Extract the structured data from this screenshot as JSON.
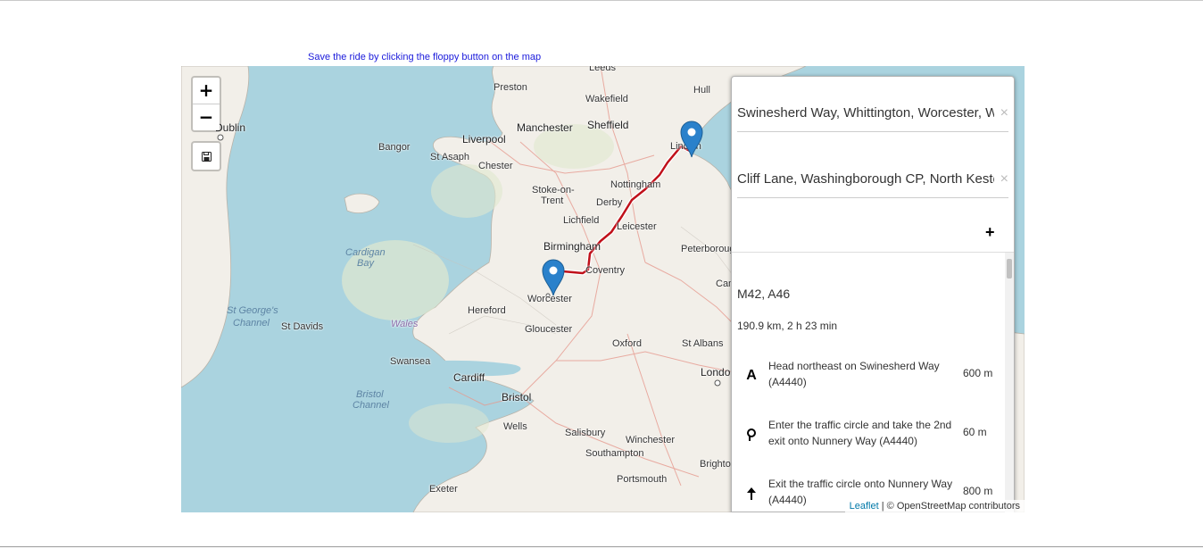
{
  "hint": "Save the ride by clicking the floppy button on the map",
  "zoom": {
    "in": "+",
    "out": "−"
  },
  "places": [
    {
      "name": "Leeds"
    },
    {
      "name": "Preston"
    },
    {
      "name": "Wakefield"
    },
    {
      "name": "Hull"
    },
    {
      "name": "Manchester"
    },
    {
      "name": "Sheffield"
    },
    {
      "name": "Liverpool"
    },
    {
      "name": "Bangor"
    },
    {
      "name": "St Asaph"
    },
    {
      "name": "Chester"
    },
    {
      "name": "Lincoln"
    },
    {
      "name": "Dublin"
    },
    {
      "name": "Nottingham"
    },
    {
      "name": "Stoke-on-"
    },
    {
      "name": "Trent"
    },
    {
      "name": "Derby"
    },
    {
      "name": "Lichfield"
    },
    {
      "name": "Leicester"
    },
    {
      "name": "Peterborough"
    },
    {
      "name": "Birmingham"
    },
    {
      "name": "Coventry"
    },
    {
      "name": "Worcester"
    },
    {
      "name": "Cam"
    },
    {
      "name": "Hereford"
    },
    {
      "name": "St Davids"
    },
    {
      "name": "Gloucester"
    },
    {
      "name": "Oxford"
    },
    {
      "name": "St Albans"
    },
    {
      "name": "Swansea"
    },
    {
      "name": "Cardiff"
    },
    {
      "name": "Londo"
    },
    {
      "name": "Bristol"
    },
    {
      "name": "Wells"
    },
    {
      "name": "Salisbury"
    },
    {
      "name": "Winchester"
    },
    {
      "name": "Southampton"
    },
    {
      "name": "Brighto"
    },
    {
      "name": "Portsmouth"
    },
    {
      "name": "Exeter"
    }
  ],
  "seas": [
    {
      "name": "Cardigan"
    },
    {
      "name": "Bay"
    },
    {
      "name": "St George's"
    },
    {
      "name": "Channel"
    },
    {
      "name": "Bristol"
    },
    {
      "name": "Channel"
    }
  ],
  "regions": [
    {
      "name": "Wales"
    }
  ],
  "routing": {
    "start": "Swinesherd Way, Whittington, Worcester, Wychavon, Worcestershire",
    "end": "Cliff Lane, Washingborough CP, North Kesteven, Lincolnshire",
    "clear": "×",
    "add": "+",
    "route_name": "M42, A46",
    "summary": "190.9 km, 2 h 23 min",
    "instructions": [
      {
        "icon": "depart-icon",
        "glyph": "A",
        "text": "Head northeast on Swinesherd Way (A4440)",
        "distance": "600 m"
      },
      {
        "icon": "roundabout-icon",
        "glyph": "",
        "text": "Enter the traffic circle and take the 2nd exit onto Nunnery Way (A4440)",
        "distance": "60 m"
      },
      {
        "icon": "straight-arrow-icon",
        "glyph": "",
        "text": "Exit the traffic circle onto Nunnery Way (A4440)",
        "distance": "800 m"
      }
    ]
  },
  "attribution": {
    "leaflet": "Leaflet",
    "sep": " | ",
    "osm": "© OpenStreetMap contributors"
  },
  "colors": {
    "route": "#c0101a",
    "marker": "#2a81cb",
    "sea": "#aad3df",
    "land": "#f2efe9"
  }
}
